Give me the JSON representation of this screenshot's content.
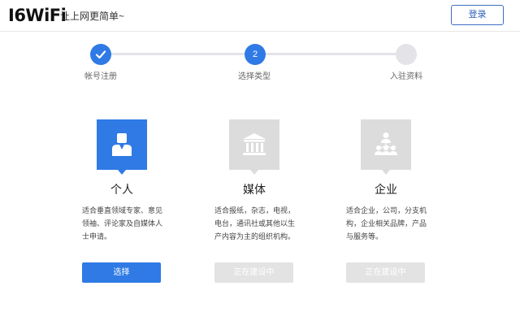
{
  "header": {
    "logo": "I6WiFi",
    "slogan": "让上网更简单~",
    "login_label": "登录"
  },
  "steps": [
    {
      "number": "",
      "label": "帐号注册",
      "state": "done"
    },
    {
      "number": "2",
      "label": "选择类型",
      "state": "active"
    },
    {
      "number": "",
      "label": "入驻资料",
      "state": "todo"
    }
  ],
  "cards": [
    {
      "title": "个人",
      "description": "适合垂直领域专家、意见领袖、评论家及自媒体人士申请。",
      "button": "选择",
      "icon": "person-icon"
    },
    {
      "title": "媒体",
      "description": "适合报纸，杂志，电视，电台，通讯社或其他以生产内容为主的组织机构。",
      "button": "正在建设中",
      "icon": "institution-icon"
    },
    {
      "title": "企业",
      "description": "适合企业，公司，分支机构，企业相关品牌，产品与服务等。",
      "button": "正在建设中",
      "icon": "organization-icon"
    }
  ],
  "colors": {
    "accent": "#2f7ae5",
    "disabled": "#e3e3e3",
    "icon_gray": "#dcdcdc"
  }
}
